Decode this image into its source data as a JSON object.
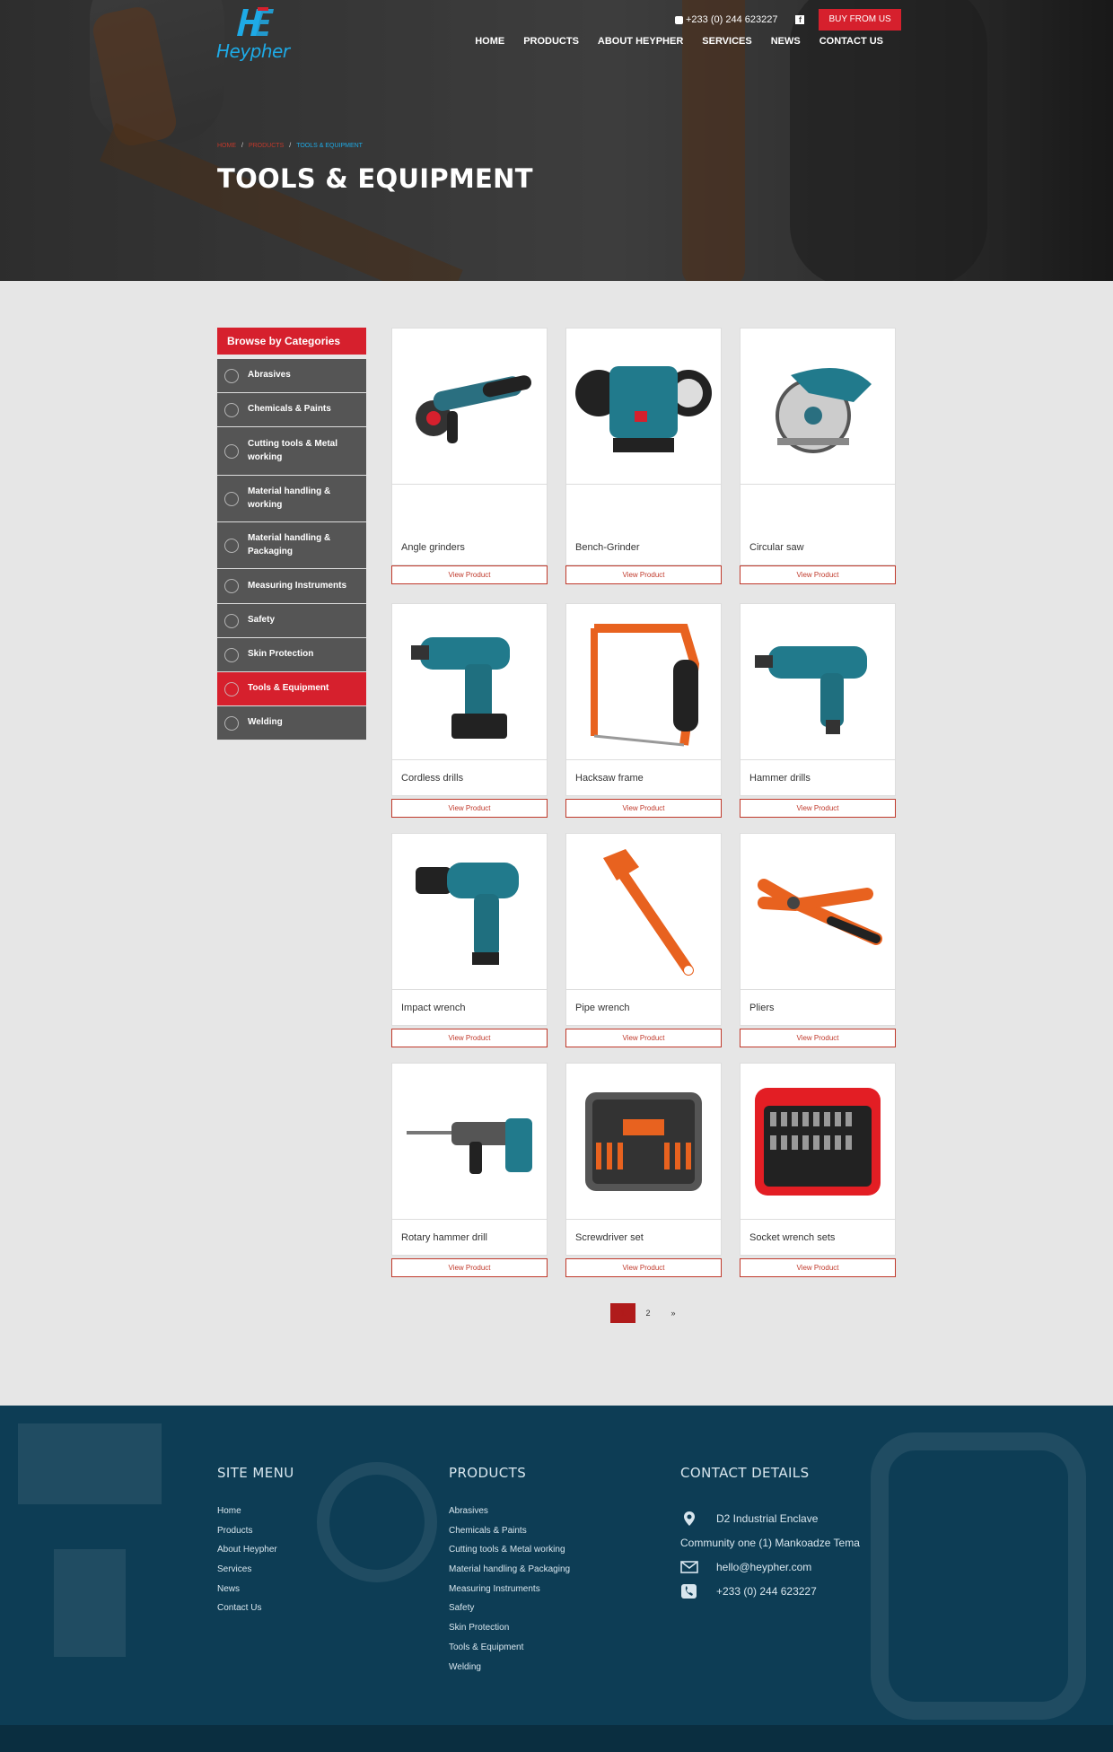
{
  "brand": {
    "name": "Heypher"
  },
  "topbar": {
    "phone": "+233 (0) 244 623227",
    "facebook": "f",
    "buy_button": "BUY FROM US"
  },
  "nav": [
    "HOME",
    "PRODUCTS",
    "ABOUT HEYPHER",
    "SERVICES",
    "NEWS",
    "CONTACT US"
  ],
  "breadcrumb": {
    "home": "HOME",
    "products": "PRODUCTS",
    "current": "TOOLS & EQUIPMENT"
  },
  "page_title": "TOOLS & EQUIPMENT",
  "sidebar": {
    "heading": "Browse by Categories",
    "items": [
      {
        "label": "Abrasives",
        "icon": "disc-icon"
      },
      {
        "label": "Chemicals & Paints",
        "icon": "chemicals-icon"
      },
      {
        "label": "Cutting tools & Metal working",
        "icon": "cutter-icon"
      },
      {
        "label": "Material handling & working",
        "icon": "box-icon"
      },
      {
        "label": "Material handling & Packaging",
        "icon": "package-icon"
      },
      {
        "label": "Measuring Instruments",
        "icon": "tape-measure-icon"
      },
      {
        "label": "Safety",
        "icon": "vest-icon"
      },
      {
        "label": "Skin Protection",
        "icon": "hand-cream-icon"
      },
      {
        "label": "Tools & Equipment",
        "icon": "tools-icon",
        "active": true
      },
      {
        "label": "Welding",
        "icon": "welding-icon"
      }
    ]
  },
  "products": [
    {
      "name": "Angle grinders",
      "button": "View Product"
    },
    {
      "name": "Bench-Grinder",
      "button": "View Product"
    },
    {
      "name": "Circular saw",
      "button": "View Product"
    },
    {
      "name": "Cordless drills",
      "button": "View Product"
    },
    {
      "name": "Hacksaw frame",
      "button": "View Product"
    },
    {
      "name": "Hammer drills",
      "button": "View Product"
    },
    {
      "name": "Impact wrench",
      "button": "View Product"
    },
    {
      "name": "Pipe wrench",
      "button": "View Product"
    },
    {
      "name": "Pliers",
      "button": "View Product"
    },
    {
      "name": "Rotary hammer drill",
      "button": "View Product"
    },
    {
      "name": "Screwdriver set",
      "button": "View Product"
    },
    {
      "name": "Socket wrench sets",
      "button": "View Product"
    }
  ],
  "pagination": {
    "current": "1",
    "next_page": "2",
    "next": "»"
  },
  "footer": {
    "site_menu": {
      "title": "SITE MENU",
      "items": [
        "Home",
        "Products",
        "About Heypher",
        "Services",
        "News",
        "Contact Us"
      ]
    },
    "products": {
      "title": "PRODUCTS",
      "items": [
        "Abrasives",
        "Chemicals & Paints",
        "Cutting tools & Metal working",
        "Material handling & Packaging",
        "Measuring Instruments",
        "Safety",
        "Skin Protection",
        "Tools & Equipment",
        "Welding"
      ]
    },
    "contact": {
      "title": "CONTACT DETAILS",
      "address_line1": "D2 Industrial Enclave",
      "address_line2": "Community one (1) Mankoadze Tema",
      "email": "hello@heypher.com",
      "phone": "+233 (0) 244 623227"
    }
  },
  "colors": {
    "accent_red": "#d6202d",
    "brand_blue": "#1eaae6",
    "footer_bg": "#0d3d55",
    "sidebar_gray": "#555555"
  }
}
